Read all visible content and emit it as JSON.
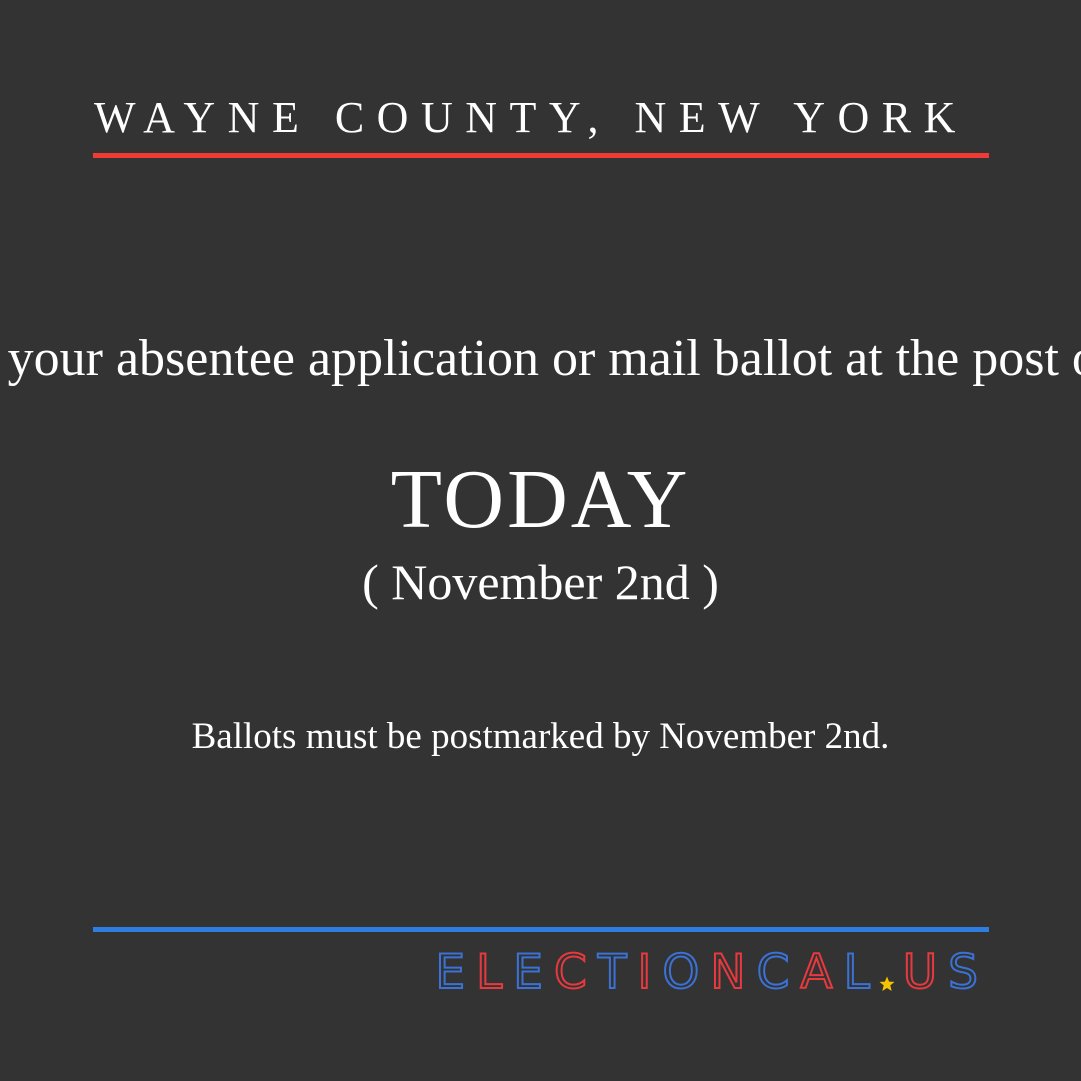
{
  "header": {
    "county": "WAYNE COUNTY, NEW YORK"
  },
  "message": {
    "instruction": "Drop your absentee application or mail ballot at the post office",
    "headline": "TODAY",
    "date": "( November 2nd )",
    "note": "Ballots must be postmarked by November 2nd."
  },
  "brand": {
    "name": "ELECTIONCAL",
    "separator_icon": "star-icon",
    "tld": "US"
  },
  "colors": {
    "background": "#333333",
    "accent_red": "#ef3b36",
    "accent_blue": "#2f7de1",
    "star": "#f5c400"
  }
}
